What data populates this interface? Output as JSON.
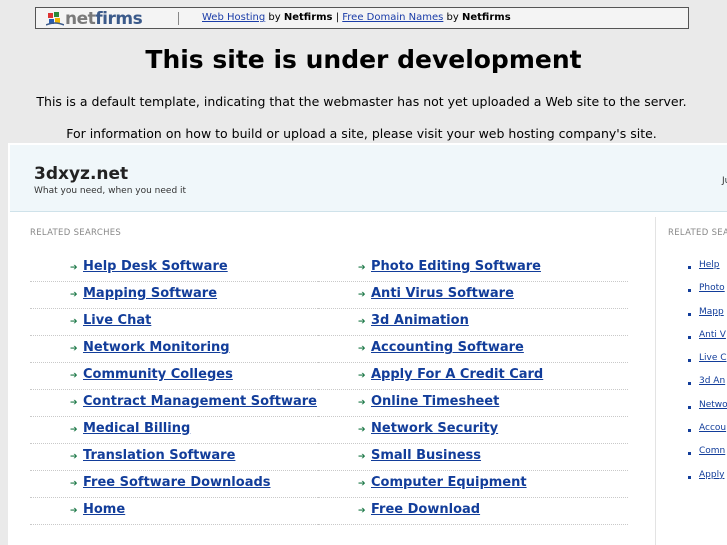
{
  "banner": {
    "logo_text_prefix": "net",
    "logo_text_suffix": "firms",
    "web_hosting_link": "Web Hosting",
    "by1": "by",
    "brand1": "Netfirms",
    "divider": "|",
    "domain_link": "Free Domain Names",
    "by2": "by",
    "brand2": "Netfirms"
  },
  "headline": "This site is under development",
  "info_line1": "This is a default template, indicating that the webmaster has not yet uploaded a Web site to the server.",
  "info_line2": "For information on how to build or upload a site, please visit your web hosting company's site.",
  "parked": {
    "site_name": "3dxyz.net",
    "tagline": "What you need, when you need it",
    "header_right_fragment": "Ju",
    "related_title": "RELATED SEARCHES",
    "left_column": [
      "Help Desk Software",
      "Mapping Software",
      "Live Chat",
      "Network Monitoring",
      "Community Colleges",
      "Contract Management Software",
      "Medical Billing",
      "Translation Software",
      "Free Software Downloads",
      "Home"
    ],
    "right_column": [
      "Photo Editing Software",
      "Anti Virus Software",
      "3d Animation",
      "Accounting Software",
      "Apply For A Credit Card",
      "Online Timesheet",
      "Network Security",
      "Small Business",
      "Computer Equipment",
      "Free Download"
    ],
    "side_title": "RELATED SEA",
    "side_items": [
      "Help",
      "Photo",
      "Mapp",
      "Anti V",
      "Live C",
      "3d An",
      "Netwo",
      "Accou",
      "Comn",
      "Apply"
    ]
  },
  "colors": {
    "link": "#123d9a",
    "arrow": "#1f7a4a",
    "header_bg": "#f0f7fa",
    "page_bg": "#eaeaea"
  }
}
